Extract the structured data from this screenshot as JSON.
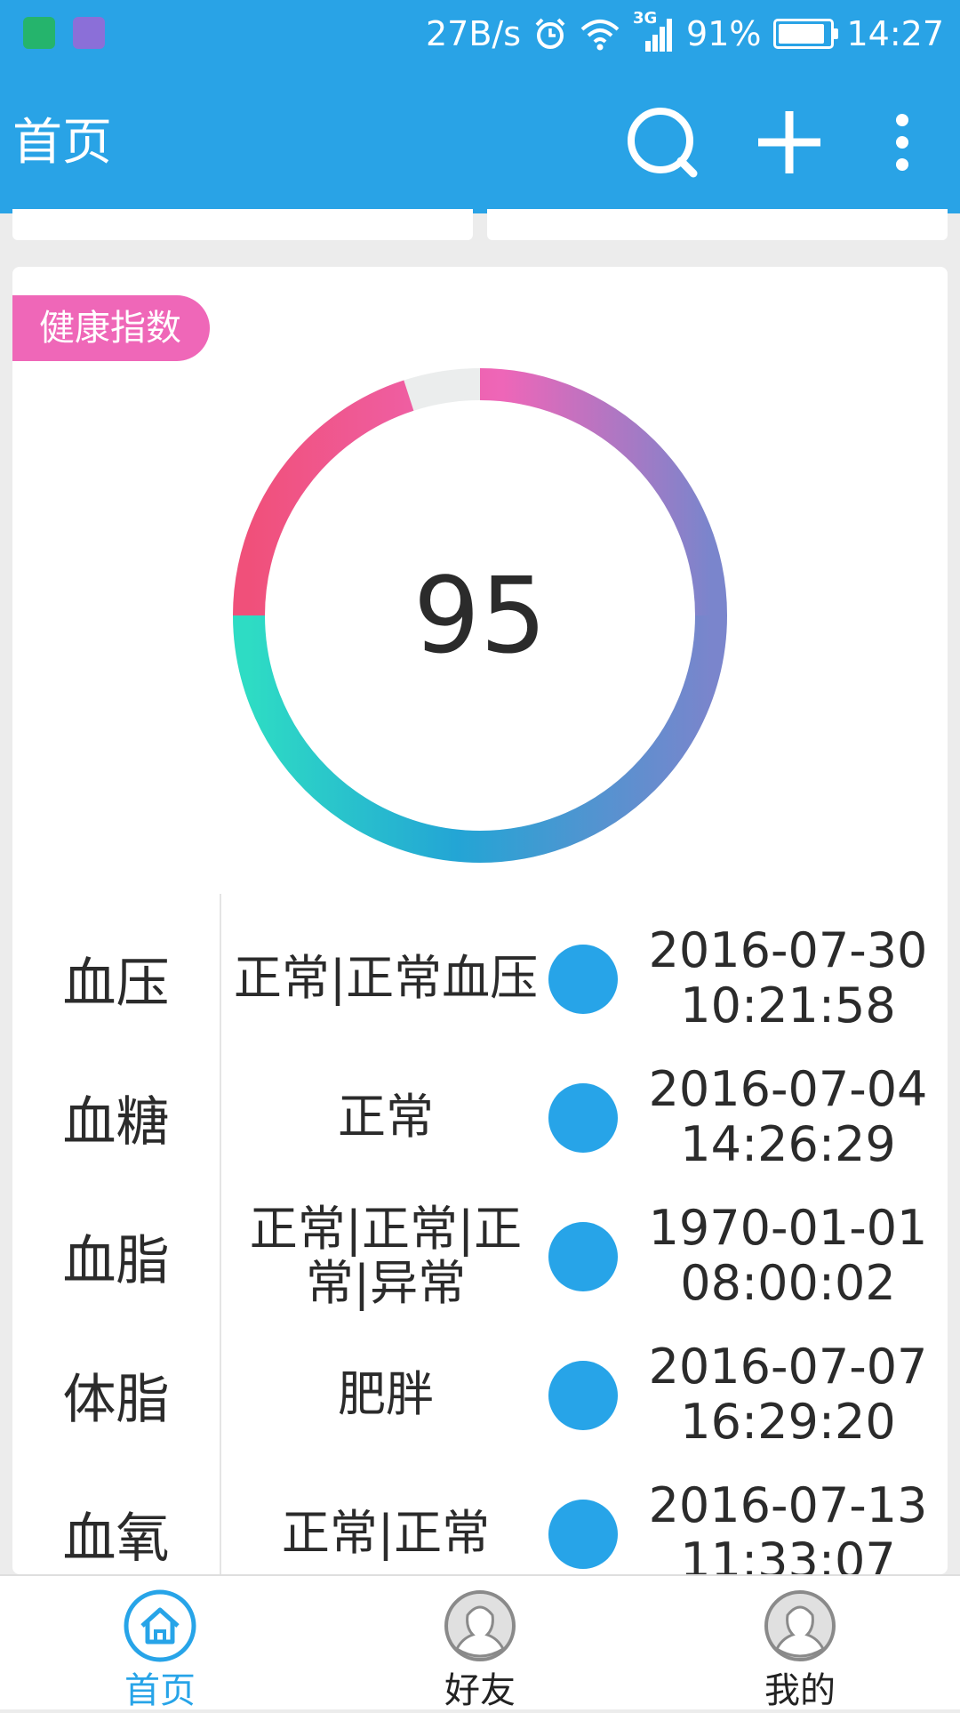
{
  "status_bar": {
    "net_speed": "27B/s",
    "signal_label": "3G",
    "battery": "91%",
    "battery_level": 0.91,
    "time": "14:27"
  },
  "app_bar": {
    "title": "首页",
    "icons": [
      "search-icon",
      "add-icon",
      "more-vert-icon"
    ]
  },
  "health_card": {
    "tag": "健康指数",
    "score": "95",
    "gauge_fill_fraction": 0.95,
    "gauge_colors": {
      "start": "#f0507a",
      "mid": "#ee66b8",
      "low": "#7a85cc",
      "left": "#23a5d5",
      "end": "#2edcc4",
      "track": "#ebeded"
    },
    "rows": [
      {
        "category": "血压",
        "status": "正常|正常血压",
        "date": "2016-07-30",
        "time": "10:21:58"
      },
      {
        "category": "血糖",
        "status": "正常",
        "date": "2016-07-04",
        "time": "14:26:29"
      },
      {
        "category": "血脂",
        "status": "正常|正常|正常|异常",
        "date": "1970-01-01",
        "time": "08:00:02"
      },
      {
        "category": "体脂",
        "status": "肥胖",
        "date": "2016-07-07",
        "time": "16:29:20"
      },
      {
        "category": "血氧",
        "status": "正常|正常",
        "date": "2016-07-13",
        "time": "11:33:07"
      }
    ],
    "dot_color": "#27a4e8"
  },
  "tab_bar": {
    "tabs": [
      {
        "label": "首页",
        "icon": "home-icon",
        "active": true
      },
      {
        "label": "好友",
        "icon": "friends-avatar-icon",
        "active": false
      },
      {
        "label": "我的",
        "icon": "profile-avatar-icon",
        "active": false
      }
    ]
  },
  "colors": {
    "primary": "#29a3e6",
    "tag": "#ef67b8",
    "background": "#ececec"
  }
}
